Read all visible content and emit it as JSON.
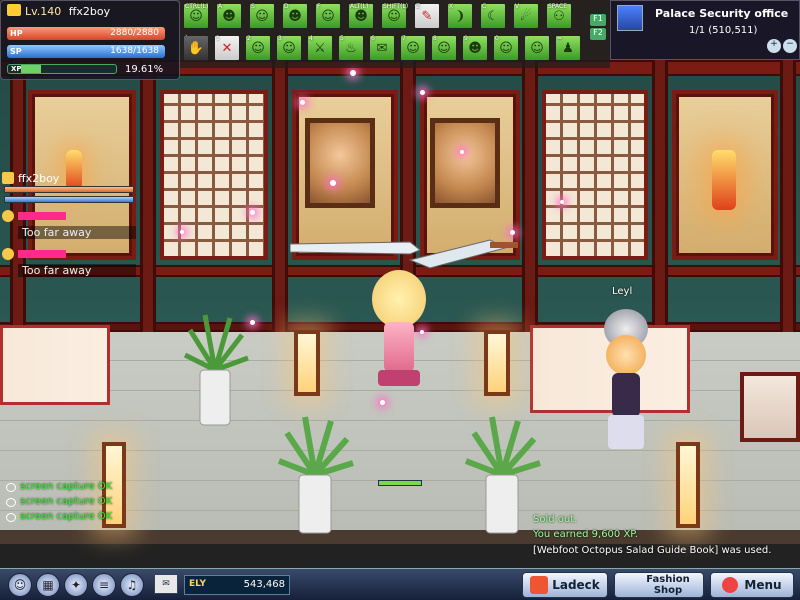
{
  "player": {
    "level": "Lv.140",
    "name": "ffx2boy",
    "hp_label": "HP",
    "hp_text": "2880/2880",
    "sp_label": "SP",
    "sp_text": "1638/1638",
    "xp_label": "XP",
    "xp_percent": "19.61%"
  },
  "hotbar": {
    "row1_keys": [
      "CTRL(L)",
      "A",
      "S",
      "D",
      "F",
      "ALT(L)",
      "SHIFT(L)",
      "Z",
      "X",
      "C",
      "V",
      "SPACE"
    ],
    "row2_keys": [
      "`",
      "1",
      "2",
      "3",
      "4",
      "5",
      "6",
      "7",
      "8",
      "9",
      "0",
      "-",
      "="
    ],
    "side_keys": [
      "F1",
      "F2"
    ]
  },
  "map": {
    "title": "Palace Security office",
    "channel": "1/1",
    "coords": "(510,511)"
  },
  "party": {
    "leader": "ffx2boy",
    "members": [
      {
        "status": "Too far away"
      },
      {
        "status": "Too far away"
      }
    ]
  },
  "player_tag": "Leyl",
  "chat": {
    "lines": [
      "screen capture OK",
      "screen capture OK",
      "screen capture OK"
    ]
  },
  "system": {
    "sold": "Sold out.",
    "xp_msg": "You earned 9,600 XP.",
    "used_msg": "[Webfoot Octopus Salad Guide Book] was used."
  },
  "currency": {
    "label": "ELY",
    "amount": "543,468"
  },
  "buttons": {
    "ladeck": "Ladeck",
    "fashion_line1": "Fashion",
    "fashion_line2": "Shop",
    "menu": "Menu"
  }
}
